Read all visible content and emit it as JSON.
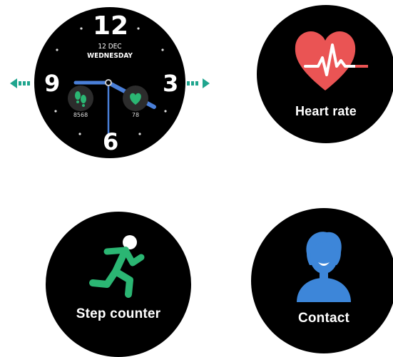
{
  "watch_face": {
    "hour_12": "12",
    "hour_3": "3",
    "hour_6": "6",
    "hour_9": "9",
    "date": "12 DEC",
    "weekday": "WEDNESDAY",
    "steps_value": "8568",
    "heart_value": "78",
    "accent_color": "#4a7fd8",
    "arrow_color": "#1fa58e"
  },
  "screens": {
    "heart_rate": {
      "label": "Heart rate",
      "icon": "heart-pulse-icon",
      "icon_color": "#ea5454"
    },
    "step_counter": {
      "label": "Step counter",
      "icon": "running-person-icon",
      "icon_color": "#2bb673"
    },
    "contact": {
      "label": "Contact",
      "icon": "person-icon",
      "icon_color": "#3d86d9"
    }
  }
}
